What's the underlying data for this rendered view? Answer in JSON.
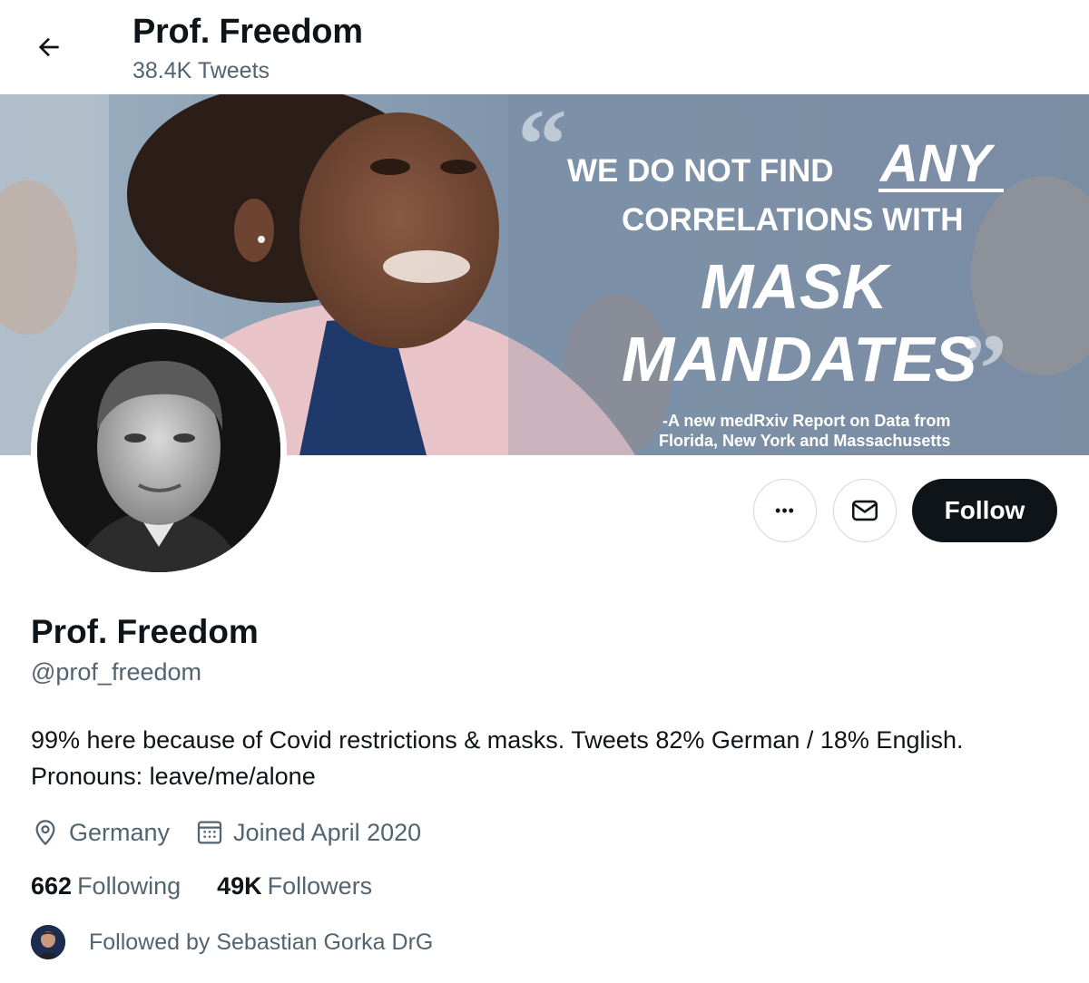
{
  "header": {
    "title": "Prof. Freedom",
    "tweet_count": "38.4K Tweets"
  },
  "banner": {
    "quote_line1": "WE DO NOT FIND",
    "quote_emph": "ANY",
    "quote_line2": "CORRELATIONS WITH",
    "quote_line3": "MASK",
    "quote_line4": "MANDATES",
    "caption_line1": "-A new medRxiv Report on Data from",
    "caption_line2": "Florida, New York and Massachusetts"
  },
  "actions": {
    "more_label": "•••",
    "follow_label": "Follow"
  },
  "profile": {
    "name": "Prof. Freedom",
    "handle": "@prof_freedom",
    "bio_line1": "99% here because of Covid restrictions & masks. Tweets 82% German / 18% English.",
    "bio_line2": "Pronouns: leave/me/alone",
    "location": "Germany",
    "joined": "Joined April 2020",
    "following_count": "662",
    "following_label": "Following",
    "followers_count": "49K",
    "followers_label": "Followers",
    "followed_by": "Followed by Sebastian Gorka DrG"
  },
  "icons": {
    "back": "arrow-left-icon",
    "more": "more-icon",
    "message": "envelope-icon",
    "location": "location-pin-icon",
    "calendar": "calendar-icon"
  },
  "colors": {
    "text": "#0f1419",
    "secondary": "#536471",
    "follow_bg": "#0f1419",
    "border": "#cfd9de"
  }
}
